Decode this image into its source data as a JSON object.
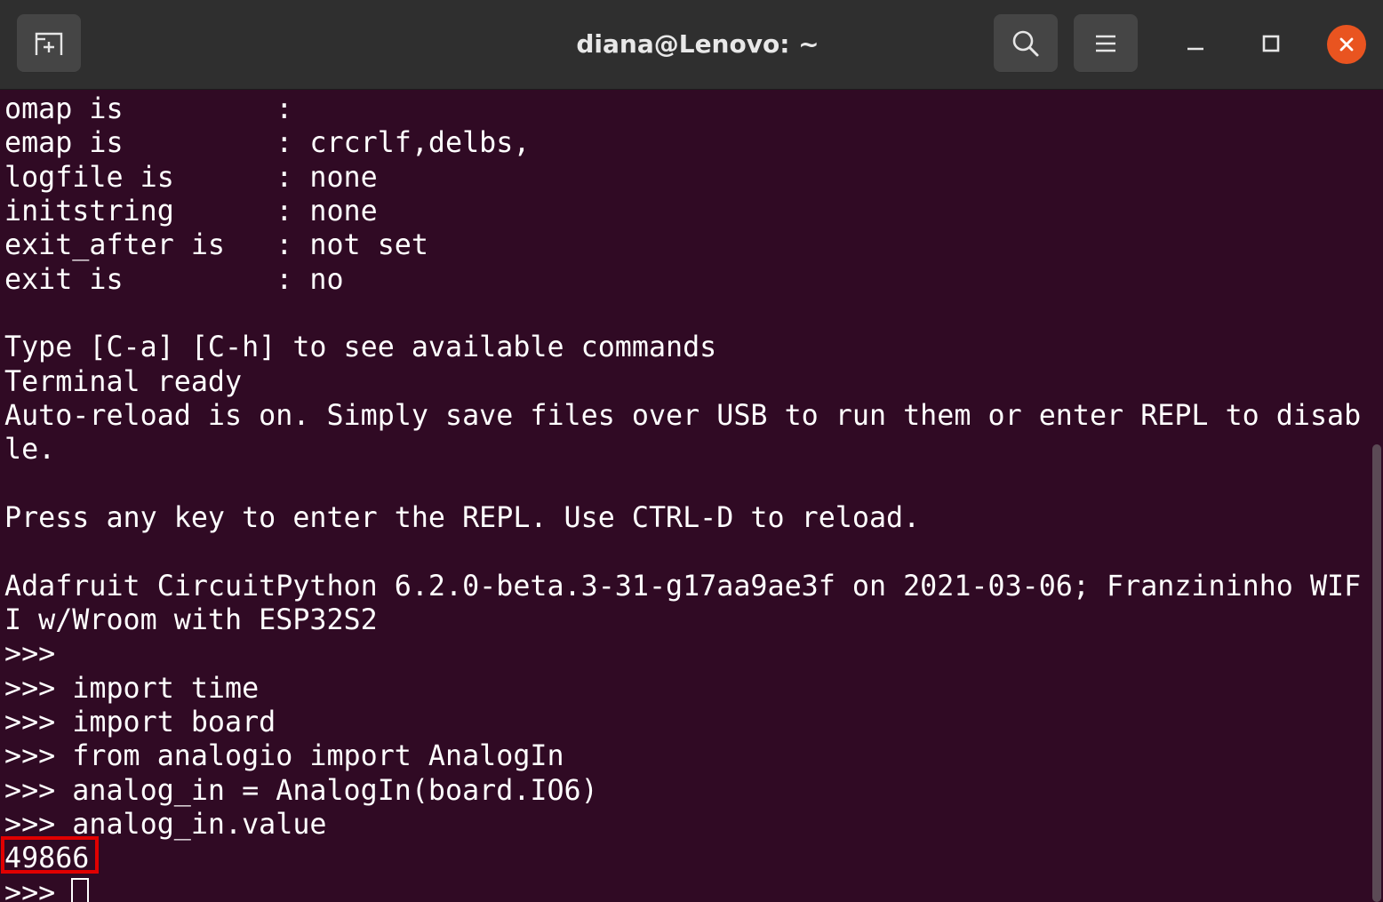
{
  "window": {
    "title": "diana@Lenovo: ~",
    "icons": {
      "new_tab": "new-tab-icon",
      "search": "search-icon",
      "menu": "hamburger-menu-icon",
      "minimize": "minimize-icon",
      "maximize": "maximize-icon",
      "close": "close-icon"
    },
    "colors": {
      "headerbar": "#2f2f2f",
      "terminal_bg": "#300a24",
      "close_button": "#e95420",
      "highlight": "#e00000"
    }
  },
  "terminal": {
    "lines": [
      "omap is         :",
      "emap is         : crcrlf,delbs,",
      "logfile is      : none",
      "initstring      : none",
      "exit_after is   : not set",
      "exit is         : no",
      "",
      "Type [C-a] [C-h] to see available commands",
      "Terminal ready",
      "Auto-reload is on. Simply save files over USB to run them or enter REPL to disab",
      "le.",
      "",
      "Press any key to enter the REPL. Use CTRL-D to reload.",
      "",
      "Adafruit CircuitPython 6.2.0-beta.3-31-g17aa9ae3f on 2021-03-06; Franzininho WIF",
      "I w/Wroom with ESP32S2",
      ">>>",
      ">>> import time",
      ">>> import board",
      ">>> from analogio import AnalogIn",
      ">>> analog_in = AnalogIn(board.IO6)",
      ">>> analog_in.value",
      "49866",
      ">>> "
    ],
    "highlighted_value": "49866"
  }
}
